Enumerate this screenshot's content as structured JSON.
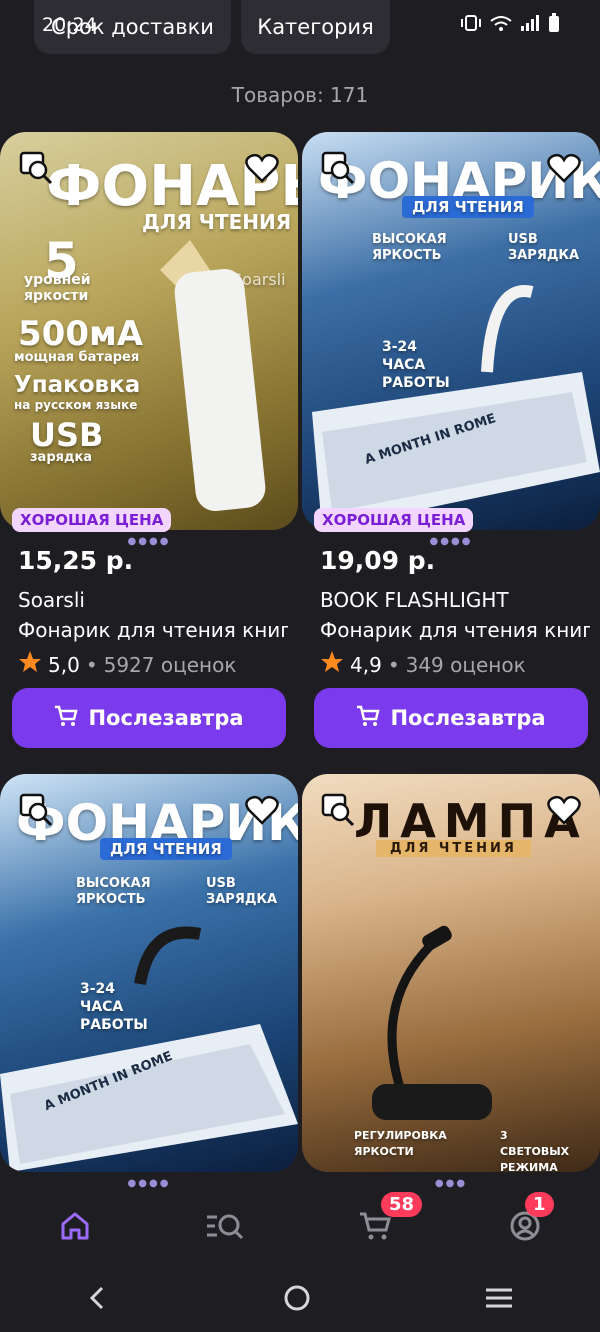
{
  "status_bar": {
    "time": "20:24"
  },
  "filters": {
    "delivery_label": "Срок доставки",
    "category_label": "Категория"
  },
  "summary": {
    "count_text": "Товаров: 171"
  },
  "products": [
    {
      "price": "15,25 р.",
      "brand": "Soarsli",
      "title": "Фонарик для чтения книг",
      "rating": "5,0",
      "reviews": "5927 оценок",
      "badge": "ХОРОШАЯ ЦЕНА",
      "buy_label": "Послезавтра",
      "image_text": {
        "headline": "ФОНАРЬ",
        "sub": "ДЛЯ ЧТЕНИЯ",
        "f1": "5",
        "f1b": "уровней яркости",
        "f2": "500мА",
        "f2b": "мощная батарея",
        "f3": "Упаковка",
        "f3b": "на русском языке",
        "f4": "USB",
        "f4b": "зарядка",
        "logo": "Soarsli"
      }
    },
    {
      "price": "19,09 р.",
      "brand": "BOOK FLASHLIGHT",
      "title": "Фонарик для чтения книг",
      "rating": "4,9",
      "reviews": "349 оценок",
      "badge": "ХОРОШАЯ ЦЕНА",
      "buy_label": "Послезавтра",
      "image_text": {
        "headline": "ФОНАРИК",
        "sub": "ДЛЯ ЧТЕНИЯ",
        "feat1": "ВЫСОКАЯ ЯРКОСТЬ",
        "feat2": "USB ЗАРЯДКА",
        "feat3": "3-24 ЧАСА РАБОТЫ",
        "book": "A MONTH IN ROME"
      }
    },
    {
      "image_text": {
        "headline": "ФОНАРИК",
        "sub": "ДЛЯ ЧТЕНИЯ",
        "feat1": "ВЫСОКАЯ ЯРКОСТЬ",
        "feat2": "USB ЗАРЯДКА",
        "feat3": "3-24 ЧАСА РАБОТЫ",
        "book": "A MONTH IN ROME"
      }
    },
    {
      "image_text": {
        "headline": "ЛАМПА",
        "sub": "ДЛЯ ЧТЕНИЯ",
        "feat1": "РЕГУЛИРОВКА ЯРКОСТИ",
        "feat2": "3 СВЕТОВЫХ РЕЖИМА"
      }
    }
  ],
  "nav": {
    "cart_badge": "58",
    "profile_badge": "1"
  },
  "colors": {
    "accent": "#7c3aed",
    "badge_bg": "#f3d6ff",
    "badge_text": "#7a1fd6",
    "star": "#ff8a1f",
    "notify": "#ff3b5c"
  },
  "icons": [
    "zoom-icon",
    "heart-icon",
    "cart-icon",
    "star-icon",
    "home-icon",
    "catalog-search-icon",
    "profile-icon",
    "back-icon",
    "home-circle-icon",
    "menu-icon"
  ]
}
